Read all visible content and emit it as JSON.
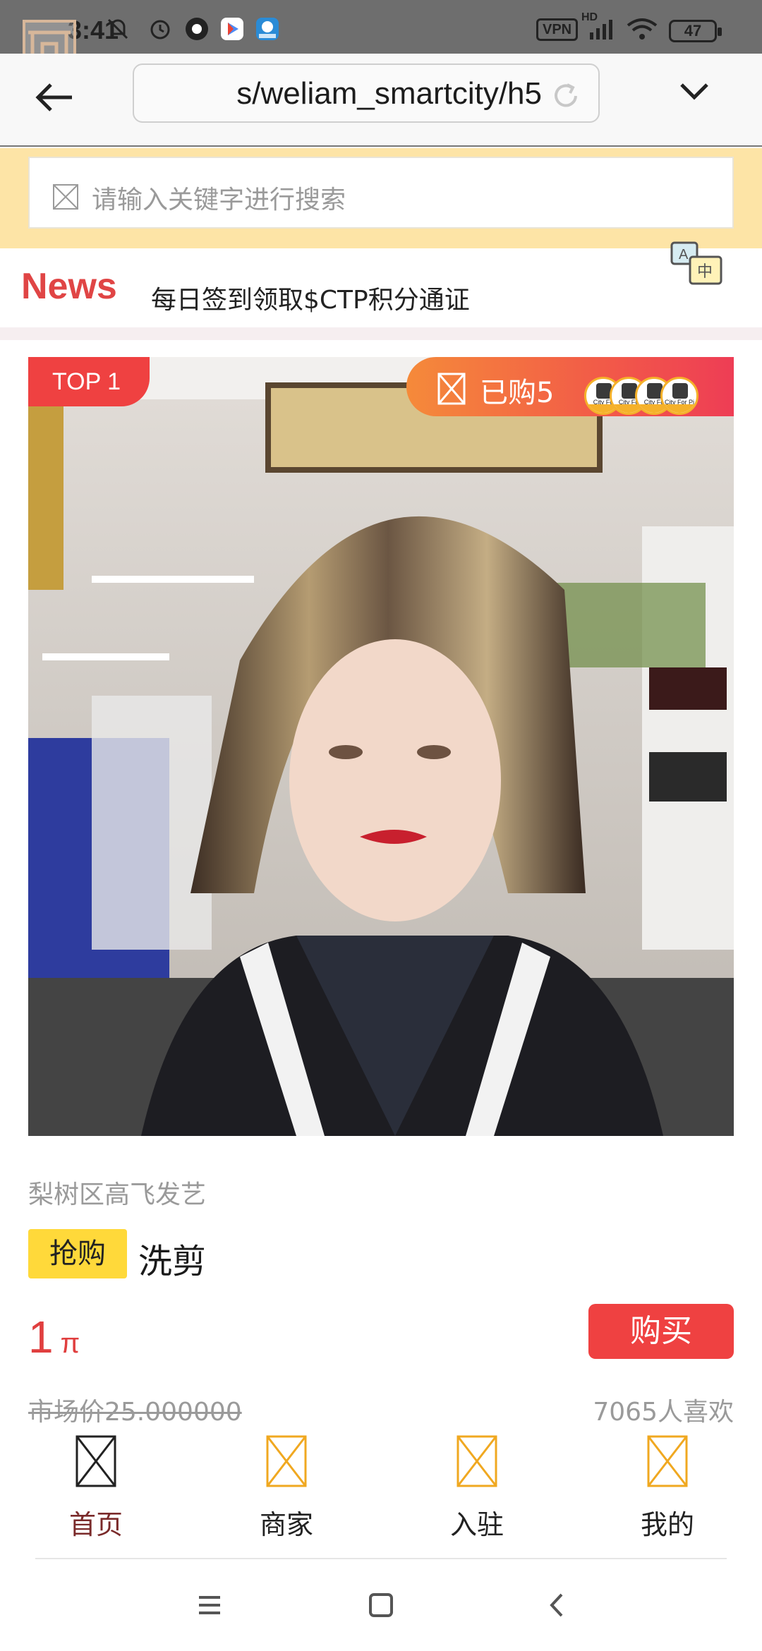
{
  "status_bar": {
    "time": "3:41",
    "vpn": "VPN",
    "signal_label": "HD",
    "battery": "47",
    "icons": [
      "mute-icon",
      "alarm-icon",
      "app-icon",
      "play-store-icon",
      "app-badge-icon",
      "signal-icon",
      "wifi-icon"
    ]
  },
  "browser": {
    "url": "s/weliam_smartcity/h5",
    "icons": [
      "back-arrow-icon",
      "reload-icon",
      "chevron-down-icon"
    ]
  },
  "search": {
    "placeholder": "请输入关键字进行搜索"
  },
  "news": {
    "label": "News",
    "text": "每日签到领取$CTP积分通证"
  },
  "product": {
    "rank_badge": "TOP 1",
    "bought_text": "已购5",
    "buyer_avatar_texts": [
      "City Fo",
      "City Fo",
      "City Fo",
      "City For Pi"
    ],
    "shop_name": "梨树区高飞发艺",
    "tag": "抢购",
    "title": "洗剪",
    "price": "1",
    "price_unit": "π",
    "buy_button": "购买",
    "market_price": "市场价25.000000",
    "likes": "7065人喜欢"
  },
  "tabbar": {
    "items": [
      {
        "label": "首页",
        "active": true
      },
      {
        "label": "商家",
        "active": false
      },
      {
        "label": "入驻",
        "active": false
      },
      {
        "label": "我的",
        "active": false
      }
    ],
    "colors": {
      "active_icon": "#222222",
      "inactive_icon": "#f0a820",
      "active_label": "#7a2a2a"
    }
  },
  "colors": {
    "accent_red": "#ef4141",
    "search_bg": "#fde4a6",
    "rush_tag": "#ffd93a"
  }
}
